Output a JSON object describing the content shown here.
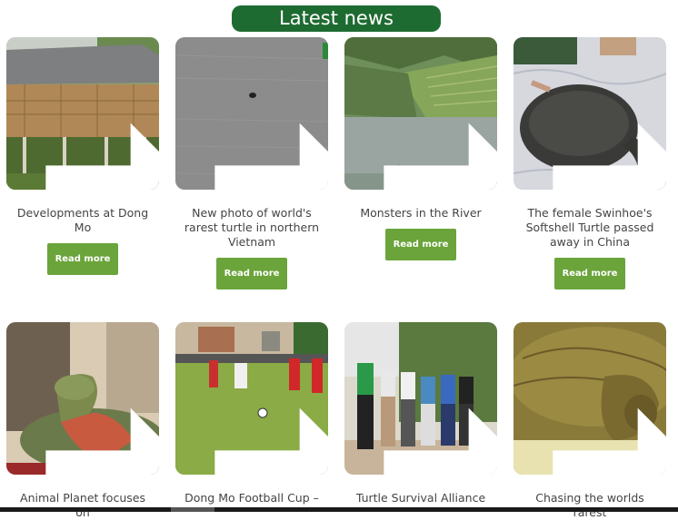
{
  "header": {
    "title": "Latest news"
  },
  "cards": [
    {
      "title": "Developments at Dong Mo",
      "button": "Read more"
    },
    {
      "title": "New photo of world's rarest turtle in northern Vietnam",
      "button": "Read more"
    },
    {
      "title": "Monsters in the River",
      "button": "Read more"
    },
    {
      "title": "The female Swinhoe's Softshell Turtle passed away in China",
      "button": "Read more"
    },
    {
      "title": "Animal Planet focuses on"
    },
    {
      "title": "Dong Mo Football Cup –"
    },
    {
      "title": "Turtle Survival Alliance"
    },
    {
      "title": "Chasing the worlds rarest"
    }
  ],
  "icons": {
    "card_arrow": "arrow-right-icon"
  },
  "colors": {
    "header_bg": "#1e6b31",
    "button_bg": "#6aa43a"
  }
}
